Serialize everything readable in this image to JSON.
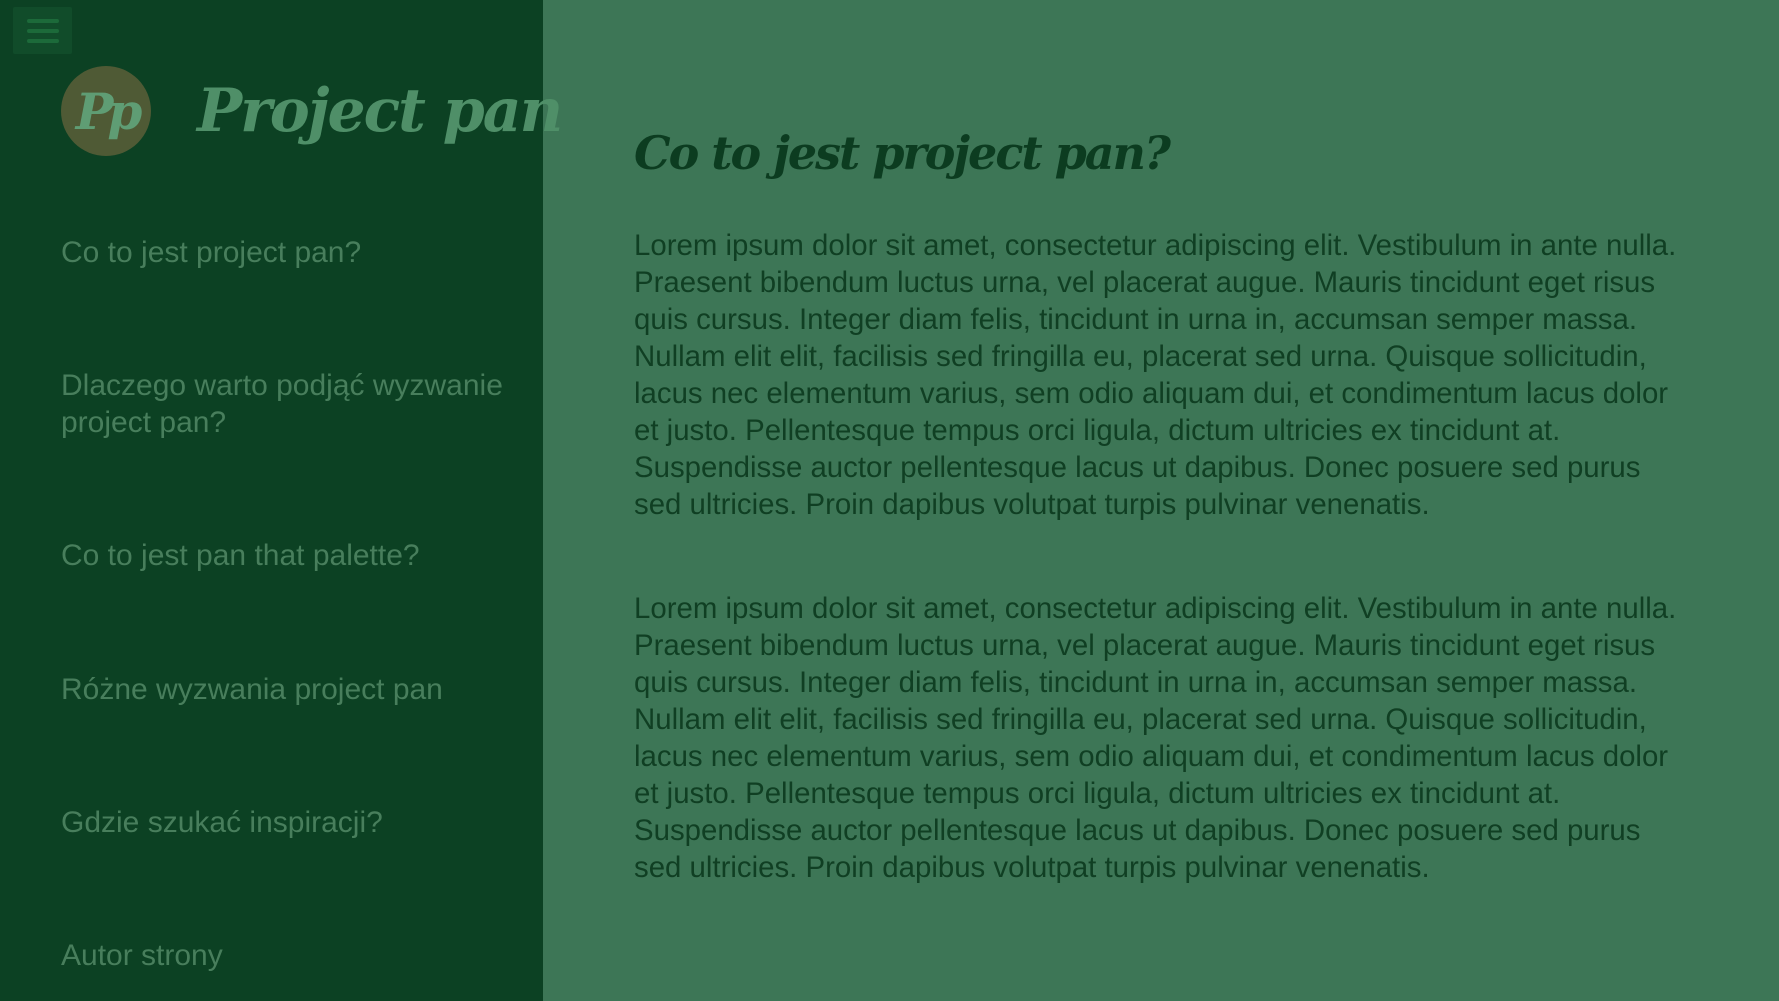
{
  "sidebar": {
    "brand": {
      "logo_text": "Pp",
      "title": "Project pan"
    },
    "nav": [
      {
        "label": "Co to jest project pan?"
      },
      {
        "label": "Dlaczego warto podjąć wyzwanie project pan?"
      },
      {
        "label": "Co to jest pan that palette?"
      },
      {
        "label": "Różne wyzwania project pan"
      },
      {
        "label": "Gdzie szukać inspiracji?"
      },
      {
        "label": "Autor strony"
      }
    ]
  },
  "main": {
    "heading": "Co to jest project pan?",
    "paragraphs": [
      "Lorem ipsum dolor sit amet, consectetur adipiscing elit. Vestibulum in ante nulla. Praesent bibendum luctus urna, vel placerat augue. Mauris tincidunt eget risus quis cursus. Integer diam felis, tincidunt in urna in, accumsan semper massa. Nullam elit elit, facilisis sed fringilla eu, placerat sed urna. Quisque sollicitudin, lacus nec elementum varius, sem odio aliquam dui, et condimentum lacus dolor et justo. Pellentesque tempus orci ligula, dictum ultricies ex tincidunt at. Suspendisse auctor pellentesque lacus ut dapibus. Donec posuere sed purus sed ultricies. Proin dapibus volutpat turpis pulvinar venenatis.",
      "Lorem ipsum dolor sit amet, consectetur adipiscing elit. Vestibulum in ante nulla. Praesent bibendum luctus urna, vel placerat augue. Mauris tincidunt eget risus quis cursus. Integer diam felis, tincidunt in urna in, accumsan semper massa. Nullam elit elit, facilisis sed fringilla eu, placerat sed urna. Quisque sollicitudin, lacus nec elementum varius, sem odio aliquam dui, et condimentum lacus dolor et justo. Pellentesque tempus orci ligula, dictum ultricies ex tincidunt at. Suspendisse auctor pellentesque lacus ut dapibus. Donec posuere sed purus sed ultricies. Proin dapibus volutpat turpis pulvinar venenatis."
    ]
  },
  "icons": {
    "menu": "hamburger-menu-icon",
    "logo": "project-pan-logo"
  },
  "colors": {
    "sidebar_bg": "#0c4123",
    "main_bg": "#3d7656",
    "nav_text": "#487e5c",
    "heading_text": "#0c3c20",
    "logo_circle": "#4f5a35"
  }
}
